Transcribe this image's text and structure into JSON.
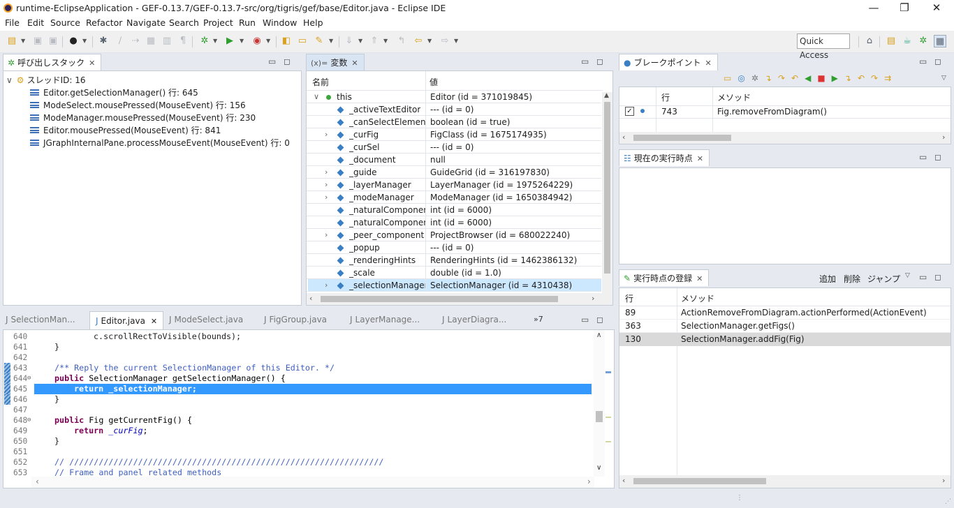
{
  "window": {
    "title": "runtime-EclipseApplication - GEF-0.13.7/GEF-0.13.7-src/org/tigris/gef/base/Editor.java - Eclipse IDE",
    "controls": {
      "minimize": "—",
      "maximize": "❐",
      "close": "✕"
    }
  },
  "menu": [
    "File",
    "Edit",
    "Source",
    "Refactor",
    "Navigate",
    "Search",
    "Project",
    "Run",
    "Window",
    "Help"
  ],
  "quick_access": "Quick Access",
  "callstack": {
    "tab": "呼び出しスタック",
    "thread": "スレッドID: 16",
    "frames": [
      "Editor.getSelectionManager() 行: 645",
      "ModeSelect.mousePressed(MouseEvent) 行: 156",
      "ModeManager.mousePressed(MouseEvent) 行: 230",
      "Editor.mousePressed(MouseEvent) 行: 841",
      "JGraphInternalPane.processMouseEvent(MouseEvent) 行: 0"
    ]
  },
  "variables": {
    "tab_prefix": "(x)=",
    "tab": "変数",
    "col_name": "名前",
    "col_value": "値",
    "rows": [
      {
        "name": "this",
        "value": "Editor (id = 371019845)",
        "expand": "∨",
        "kind": "root"
      },
      {
        "name": "_activeTextEditor",
        "value": "--- (id = 0)",
        "expand": "",
        "kind": "field"
      },
      {
        "name": "_canSelectElements",
        "value": "boolean (id = true)",
        "expand": "",
        "kind": "field"
      },
      {
        "name": "_curFig",
        "value": "FigClass (id = 1675174935)",
        "expand": "›",
        "kind": "field"
      },
      {
        "name": "_curSel",
        "value": "--- (id = 0)",
        "expand": "",
        "kind": "field"
      },
      {
        "name": "_document",
        "value": "null",
        "expand": "",
        "kind": "field"
      },
      {
        "name": "_guide",
        "value": "GuideGrid (id = 316197830)",
        "expand": "›",
        "kind": "field"
      },
      {
        "name": "_layerManager",
        "value": "LayerManager (id = 1975264229)",
        "expand": "›",
        "kind": "field"
      },
      {
        "name": "_modeManager",
        "value": "ModeManager (id = 1650384942)",
        "expand": "›",
        "kind": "field"
      },
      {
        "name": "_naturalComponentH",
        "value": "int (id = 6000)",
        "expand": "",
        "kind": "field"
      },
      {
        "name": "_naturalComponentW",
        "value": "int (id = 6000)",
        "expand": "",
        "kind": "field"
      },
      {
        "name": "_peer_component",
        "value": "ProjectBrowser (id = 680022240)",
        "expand": "›",
        "kind": "field"
      },
      {
        "name": "_popup",
        "value": "--- (id = 0)",
        "expand": "",
        "kind": "field"
      },
      {
        "name": "_renderingHints",
        "value": "RenderingHints (id = 1462386132)",
        "expand": "",
        "kind": "field"
      },
      {
        "name": "_scale",
        "value": "double (id = 1.0)",
        "expand": "",
        "kind": "field"
      },
      {
        "name": "_selectionManager",
        "value": "SelectionManager (id = 4310438)",
        "expand": "›",
        "kind": "field",
        "selected": true
      }
    ]
  },
  "breakpoints": {
    "tab": "ブレークポイント",
    "col_line": "行",
    "col_method": "メソッド",
    "rows": [
      {
        "line": "743",
        "method": "Fig.removeFromDiagram()",
        "checked": true
      }
    ]
  },
  "current_exec": {
    "tab": "現在の実行時点"
  },
  "exec_log": {
    "tab": "実行時点の登録",
    "actions": [
      "追加",
      "削除",
      "ジャンプ"
    ],
    "col_line": "行",
    "col_method": "メソッド",
    "rows": [
      {
        "line": "89",
        "method": "ActionRemoveFromDiagram.actionPerformed(ActionEvent)"
      },
      {
        "line": "363",
        "method": "SelectionManager.getFigs()"
      },
      {
        "line": "130",
        "method": "SelectionManager.addFig(Fig)",
        "selected": true
      }
    ]
  },
  "editor": {
    "tabs": [
      {
        "label": "SelectionMan...",
        "active": false
      },
      {
        "label": "Editor.java",
        "active": true
      },
      {
        "label": "ModeSelect.java",
        "active": false
      },
      {
        "label": "FigGroup.java",
        "active": false
      },
      {
        "label": "LayerManage...",
        "active": false
      },
      {
        "label": "LayerDiagra...",
        "active": false
      }
    ],
    "overflow": "»7",
    "lines": [
      {
        "n": "640",
        "code": "c.scrollRectToVisible(bounds);",
        "indent": 3
      },
      {
        "n": "641",
        "code": "}",
        "indent": 1
      },
      {
        "n": "642",
        "code": "",
        "indent": 0
      },
      {
        "n": "643",
        "code": "/** Reply the current SelectionManager of this Editor. */",
        "indent": 1,
        "style": "comment"
      },
      {
        "n": "644",
        "code": "public SelectionManager getSelectionManager() {",
        "indent": 1,
        "style": "decl",
        "fold": "⊖"
      },
      {
        "n": "645",
        "code": "return _selectionManager;",
        "indent": 2,
        "style": "ret",
        "highlight": true
      },
      {
        "n": "646",
        "code": "}",
        "indent": 1
      },
      {
        "n": "647",
        "code": "",
        "indent": 0
      },
      {
        "n": "648",
        "code": "public Fig getCurrentFig() {",
        "indent": 1,
        "style": "decl",
        "fold": "⊖"
      },
      {
        "n": "649",
        "code": "return _curFig;",
        "indent": 2,
        "style": "ret"
      },
      {
        "n": "650",
        "code": "}",
        "indent": 1
      },
      {
        "n": "651",
        "code": "",
        "indent": 0
      },
      {
        "n": "652",
        "code": "// ////////////////////////////////////////////////////////////////",
        "indent": 1,
        "style": "comment"
      },
      {
        "n": "653",
        "code": "// Frame and panel related methods",
        "indent": 1,
        "style": "comment"
      }
    ]
  },
  "colors": {
    "selection": "#cce8ff",
    "editor_highlight": "#3399ff",
    "keyword": "#7f0055",
    "comment": "#3f5fbf",
    "field": "#0000c0"
  }
}
